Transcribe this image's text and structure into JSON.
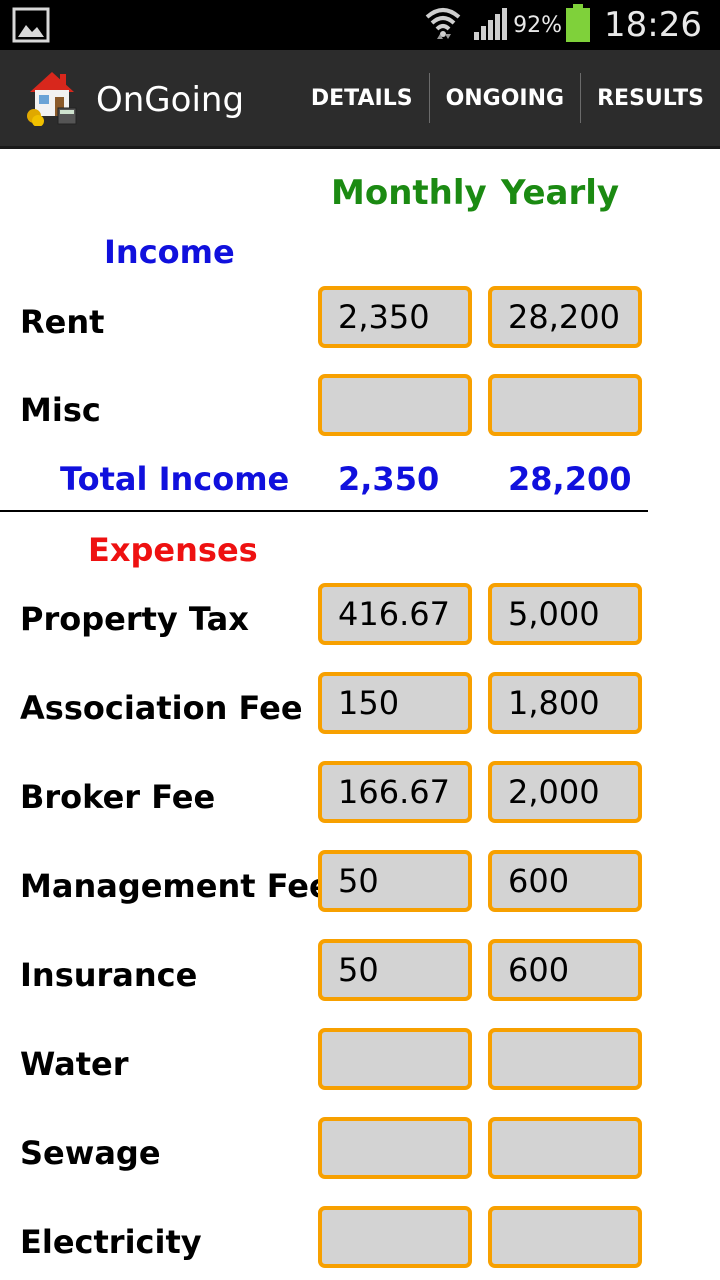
{
  "status_bar": {
    "battery_percent": "92%",
    "clock": "18:26",
    "icons": [
      "image-icon",
      "wifi-icon",
      "signal-icon",
      "battery-icon"
    ]
  },
  "action_bar": {
    "title": "OnGoing",
    "tabs": [
      "DETAILS",
      "ONGOING",
      "RESULTS"
    ]
  },
  "columns": {
    "monthly": "Monthly",
    "yearly": "Yearly"
  },
  "income": {
    "heading": "Income",
    "rows": [
      {
        "label": "Rent",
        "monthly": "2,350",
        "yearly": "28,200"
      },
      {
        "label": "Misc",
        "monthly": "",
        "yearly": ""
      }
    ],
    "total_label": "Total Income",
    "total_monthly": "2,350",
    "total_yearly": "28,200"
  },
  "expenses": {
    "heading": "Expenses",
    "rows": [
      {
        "label": "Property Tax",
        "monthly": "416.67",
        "yearly": "5,000"
      },
      {
        "label": "Association Fee",
        "monthly": "150",
        "yearly": "1,800"
      },
      {
        "label": "Broker Fee",
        "monthly": "166.67",
        "yearly": "2,000"
      },
      {
        "label": "Management Fee",
        "monthly": "50",
        "yearly": "600"
      },
      {
        "label": "Insurance",
        "monthly": "50",
        "yearly": "600"
      },
      {
        "label": "Water",
        "monthly": "",
        "yearly": ""
      },
      {
        "label": "Sewage",
        "monthly": "",
        "yearly": ""
      },
      {
        "label": "Electricity",
        "monthly": "",
        "yearly": ""
      }
    ]
  },
  "colors": {
    "column_header": "#1b8a12",
    "income": "#1010dd",
    "expenses": "#ee1111",
    "field_border": "#f7a000",
    "field_fill": "#d3d3d3"
  }
}
